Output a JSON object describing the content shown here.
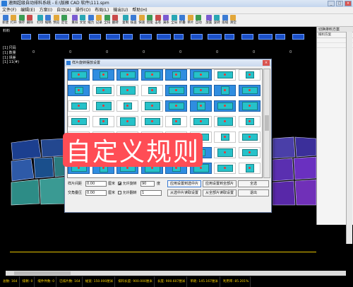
{
  "window": {
    "title": "速图超级自动排料系统 - E:\\版雁 CAD 软件\\111.spm",
    "controls": [
      "_",
      "□",
      "×"
    ]
  },
  "menu": [
    "文件(F)",
    "编辑(E)",
    "方案(I)",
    "自动(A)",
    "操作(O)",
    "布局(L)",
    "输出(U)",
    "帮助(H)"
  ],
  "toolbar": [
    "新建",
    "打开",
    "保存",
    "删除",
    "",
    "打印",
    "缩略",
    "预览",
    "定位",
    "",
    "重排",
    "文仗",
    "缩力",
    "记录",
    "全排",
    "翻转",
    "",
    "复制",
    "核查",
    "快速",
    "智能",
    "击卷",
    "满条",
    "全局",
    "折叠",
    "单片",
    "自动",
    "",
    "放置",
    "旋转",
    "嵌缝",
    "清空"
  ],
  "strip": {
    "labels": [
      "料料",
      "[1] 尺码",
      "[1] 数量",
      "[1] 误差",
      "[1] 11(#)"
    ],
    "numbers": [
      "0",
      "0",
      "0",
      "0",
      "0",
      "0",
      "0",
      "0"
    ]
  },
  "right_panel": {
    "title": "切换排料方案",
    "header": "排料方案"
  },
  "dialog": {
    "title": "样片旋转摆放设置",
    "close": "×",
    "labels": {
      "spacing": "样片间距",
      "spacing_unit": "厘米",
      "allow_rotate": "允许旋转",
      "rotate_unit": "度",
      "overlap": "交角叠压",
      "overlap_unit": "厘米",
      "allow_flip": "允许翻转"
    },
    "values": {
      "spacing": "0.00",
      "rotate": "90",
      "overlap": "0.00",
      "flip": "1"
    },
    "buttons": {
      "apply_selected": "应用设置到选中片",
      "apply_all": "应用设置到全部片",
      "select_all": "全选",
      "load_selected": "从选中片读取设置",
      "load_all": "从全部片读取设置",
      "exit": "退出"
    }
  },
  "overlay": {
    "text": "自定义规则"
  },
  "status": [
    "总数: 164",
    "排剩: 0",
    "缝件件数: 0",
    "已排片数: 164",
    "幅宽: 150.000厘米",
    "排料长度: 900.000厘米",
    "长度: 900.607厘米",
    "单耗: 145.167厘米",
    "利用率: 85.201%"
  ]
}
